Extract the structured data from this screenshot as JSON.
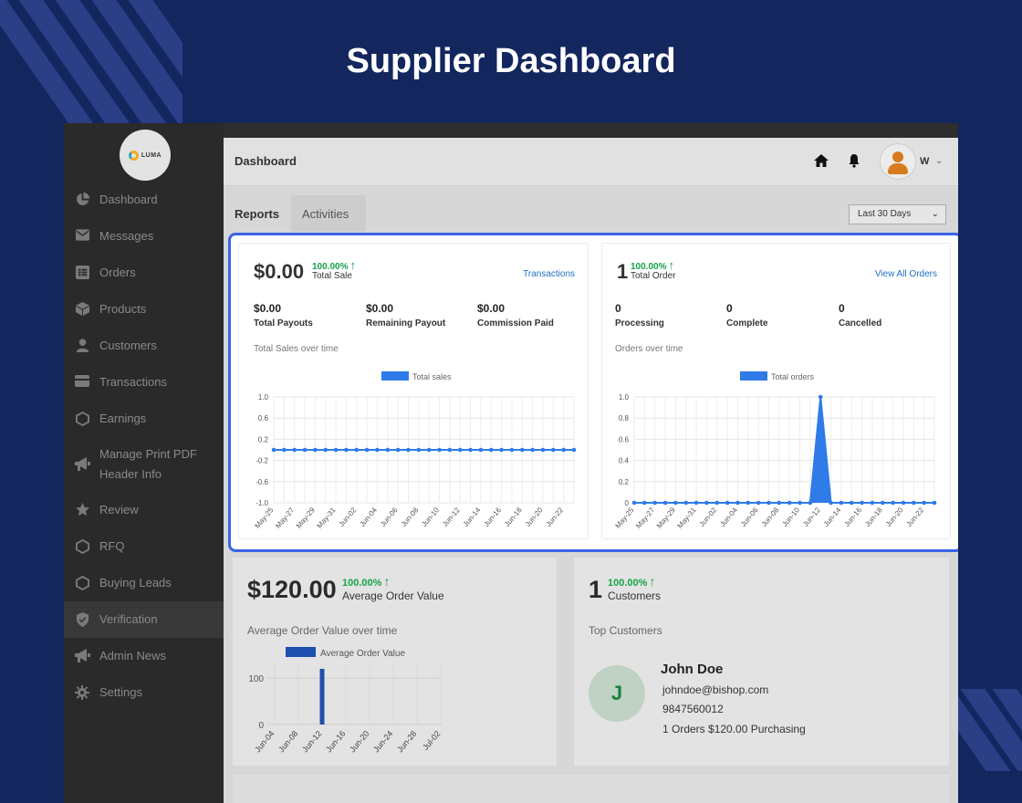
{
  "hero": {
    "title": "Supplier Dashboard"
  },
  "brand": {
    "logo_text": "LUMA"
  },
  "sidebar": {
    "items": [
      {
        "label": "Dashboard",
        "icon": "pie-chart-icon"
      },
      {
        "label": "Messages",
        "icon": "envelope-icon"
      },
      {
        "label": "Orders",
        "icon": "list-icon"
      },
      {
        "label": "Products",
        "icon": "box-icon"
      },
      {
        "label": "Customers",
        "icon": "user-icon"
      },
      {
        "label": "Transactions",
        "icon": "card-icon"
      },
      {
        "label": "Earnings",
        "icon": "hexagon-icon"
      },
      {
        "label": "Manage Print PDF Header Info",
        "icon": "megaphone-icon"
      },
      {
        "label": "Review",
        "icon": "star-icon"
      },
      {
        "label": "RFQ",
        "icon": "hexagon-icon"
      },
      {
        "label": "Buying Leads",
        "icon": "hexagon-icon"
      },
      {
        "label": "Verification",
        "icon": "shield-icon",
        "active": true
      },
      {
        "label": "Admin News",
        "icon": "megaphone-icon"
      },
      {
        "label": "Settings",
        "icon": "gear-icon"
      }
    ]
  },
  "header": {
    "title": "Dashboard",
    "user_initial": "W"
  },
  "tabs": {
    "reports": "Reports",
    "activities": "Activities"
  },
  "range": {
    "selected": "Last 30 Days"
  },
  "sales_card": {
    "big": "$0.00",
    "pct": "100.00%",
    "sub": "Total Sale",
    "link": "Transactions",
    "stats": [
      {
        "value": "$0.00",
        "label": "Total Payouts"
      },
      {
        "value": "$0.00",
        "label": "Remaining Payout"
      },
      {
        "value": "$0.00",
        "label": "Commission Paid"
      }
    ],
    "chart_title": "Total Sales over time"
  },
  "orders_card": {
    "big": "1",
    "pct": "100.00%",
    "sub": "Total Order",
    "link": "View All Orders",
    "stats": [
      {
        "value": "0",
        "label": "Processing"
      },
      {
        "value": "0",
        "label": "Complete"
      },
      {
        "value": "0",
        "label": "Cancelled"
      }
    ],
    "chart_title": "Orders over time"
  },
  "aov_card": {
    "big": "$120.00",
    "pct": "100.00%",
    "sub": "Average Order Value",
    "chart_title": "Average Order Value over time"
  },
  "customers_card": {
    "big": "1",
    "pct": "100.00%",
    "sub": "Customers",
    "title": "Top Customers",
    "customer": {
      "initial": "J",
      "name": "John Doe",
      "email": "johndoe@bishop.com",
      "phone": "9847560012",
      "summary": "1 Orders $120.00 Purchasing"
    }
  },
  "colors": {
    "accent": "#2f7be8",
    "positive": "#16a34a",
    "link": "#1e6fc6",
    "highlight": "#3b63e6"
  },
  "chart_data": [
    {
      "type": "line",
      "legend": "Total sales",
      "categories": [
        "May-25",
        "May-27",
        "May-29",
        "May-31",
        "Jun-02",
        "Jun-04",
        "Jun-06",
        "Jun-08",
        "Jun-10",
        "Jun-12",
        "Jun-14",
        "Jun-16",
        "Jun-18",
        "Jun-20",
        "Jun-22"
      ],
      "values": [
        0,
        0,
        0,
        0,
        0,
        0,
        0,
        0,
        0,
        0,
        0,
        0,
        0,
        0,
        0,
        0,
        0,
        0,
        0,
        0,
        0,
        0,
        0,
        0,
        0,
        0,
        0,
        0,
        0,
        0
      ],
      "yticks": [
        "1.0",
        "0.6",
        "0.2",
        "-0.2",
        "-0.6",
        "-1.0"
      ],
      "ylim": [
        -1,
        1
      ]
    },
    {
      "type": "area",
      "legend": "Total orders",
      "categories": [
        "May-25",
        "May-27",
        "May-29",
        "May-31",
        "Jun-02",
        "Jun-04",
        "Jun-06",
        "Jun-08",
        "Jun-10",
        "Jun-12",
        "Jun-14",
        "Jun-16",
        "Jun-18",
        "Jun-20",
        "Jun-22"
      ],
      "values": [
        0,
        0,
        0,
        0,
        0,
        0,
        0,
        0,
        0,
        0,
        0,
        0,
        0,
        0,
        0,
        0,
        0,
        0,
        1,
        0,
        0,
        0,
        0,
        0,
        0,
        0,
        0,
        0,
        0,
        0
      ],
      "yticks": [
        "1.0",
        "0.8",
        "0.6",
        "0.4",
        "0.2",
        "0"
      ],
      "ylim": [
        0,
        1
      ]
    },
    {
      "type": "bar",
      "legend": "Average Order Value",
      "categories": [
        "Jun-04",
        "Jun-08",
        "Jun-12",
        "Jun-16",
        "Jun-20",
        "Jun-24",
        "Jun-28",
        "Jul-02"
      ],
      "yticks": [
        "100",
        "0"
      ],
      "bar": {
        "x": "Jun-12",
        "value": 120
      },
      "ylim": [
        0,
        120
      ]
    }
  ]
}
